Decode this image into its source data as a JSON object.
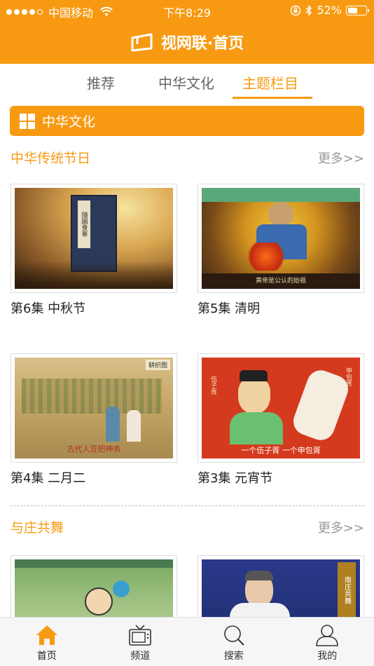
{
  "status_bar": {
    "carrier": "中国移动",
    "time": "下午8:29",
    "battery": "52%",
    "battery_level": 0.52
  },
  "header": {
    "title": "视网联·首页"
  },
  "tabs": [
    {
      "label": "推荐"
    },
    {
      "label": "中华文化"
    },
    {
      "label": "主题栏目"
    }
  ],
  "category": {
    "label": "中华文化"
  },
  "sections": [
    {
      "title": "中华传统节日",
      "more": "更多>>",
      "items": [
        {
          "label": "第6集 中秋节",
          "book_text": "隨園食單"
        },
        {
          "label": "第5集 清明",
          "subtitle": "黄帝是公认的始祖"
        },
        {
          "label": "第4集 二月二",
          "caption": "古代人豆把神务",
          "corner_tag": "耕织图"
        },
        {
          "label": "第3集 元宵节",
          "caption": "一个伍子胥  一个申包胥",
          "name_left": "伍子胥",
          "name_right": "申包胥"
        }
      ]
    },
    {
      "title": "与庄共舞",
      "more": "更多>>",
      "items": [
        {
          "label": ""
        },
        {
          "label": "",
          "banner_text": "南庄共舞"
        }
      ]
    }
  ],
  "tabbar": [
    {
      "label": "首页",
      "icon": "home-icon"
    },
    {
      "label": "频道",
      "icon": "tv-icon"
    },
    {
      "label": "搜索",
      "icon": "search-icon"
    },
    {
      "label": "我的",
      "icon": "user-icon"
    }
  ],
  "colors": {
    "accent": "#f79a12"
  }
}
